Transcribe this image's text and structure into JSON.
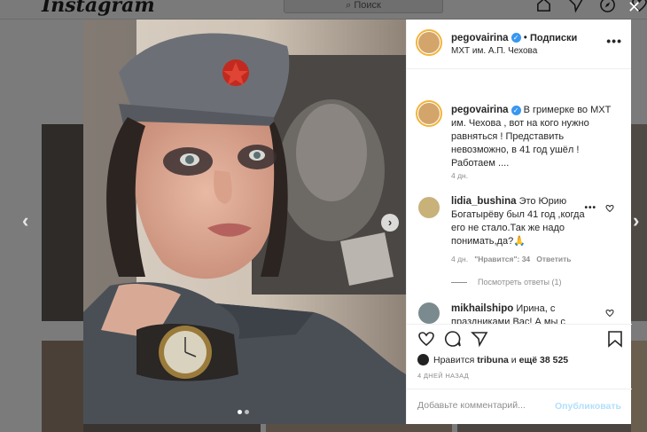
{
  "background": {
    "logo": "Instagram",
    "search_placeholder": "Поиск",
    "icons": [
      "home-icon",
      "direct-icon",
      "explore-icon",
      "heart-icon"
    ]
  },
  "post": {
    "header": {
      "username": "pegovairina",
      "separator": "•",
      "follow_label": "Подписки",
      "location": "МХТ им. А.П. Чехова",
      "more_label": "•••"
    },
    "caption": {
      "username": "pegovairina",
      "text": "В гримерке во МХТ им. Чехова , вот на кого нужно равняться ! Представить невозможно, в 41 год ушёл ! Работаем ....",
      "time": "4 дн."
    },
    "comments": [
      {
        "username": "lidia_bushina",
        "text": "Это Юрию Богатырёву был 41 год ,когда его не стало.Так же надо понимать,да?🙏",
        "time": "4 дн.",
        "likes": "\"Нравится\": 34",
        "reply": "Ответить",
        "more": "•••"
      },
      {
        "username": "mikhailshipo",
        "text": "Ирина, с праздниками Вас! А мы с женой сейчас в Муроме, а завтра"
      }
    ],
    "view_replies": "Посмотреть ответы (1)",
    "likes": {
      "prefix": "Нравится",
      "user": "tribuna",
      "middle": "и",
      "others": "ещё 38 525"
    },
    "time_ago": "4 ДНЕЙ НАЗАД",
    "add_comment_placeholder": "Добавьте комментарий...",
    "emoji_icon": "smiley-icon",
    "publish_label": "Опубликовать",
    "colors": {
      "verified": "#3897f0",
      "publish_disabled": "#b2dffc",
      "story_ring": "#f2b53a"
    }
  },
  "carousel": {
    "total": 2,
    "current": 1
  }
}
